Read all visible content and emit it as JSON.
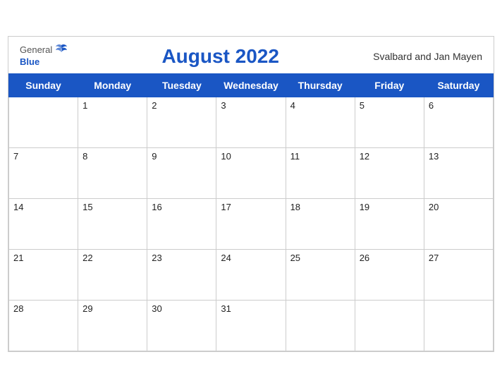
{
  "header": {
    "logo_general": "General",
    "logo_blue": "Blue",
    "month_title": "August 2022",
    "region": "Svalbard and Jan Mayen"
  },
  "days_of_week": [
    "Sunday",
    "Monday",
    "Tuesday",
    "Wednesday",
    "Thursday",
    "Friday",
    "Saturday"
  ],
  "weeks": [
    [
      "",
      "1",
      "2",
      "3",
      "4",
      "5",
      "6"
    ],
    [
      "7",
      "8",
      "9",
      "10",
      "11",
      "12",
      "13"
    ],
    [
      "14",
      "15",
      "16",
      "17",
      "18",
      "19",
      "20"
    ],
    [
      "21",
      "22",
      "23",
      "24",
      "25",
      "26",
      "27"
    ],
    [
      "28",
      "29",
      "30",
      "31",
      "",
      "",
      ""
    ]
  ]
}
